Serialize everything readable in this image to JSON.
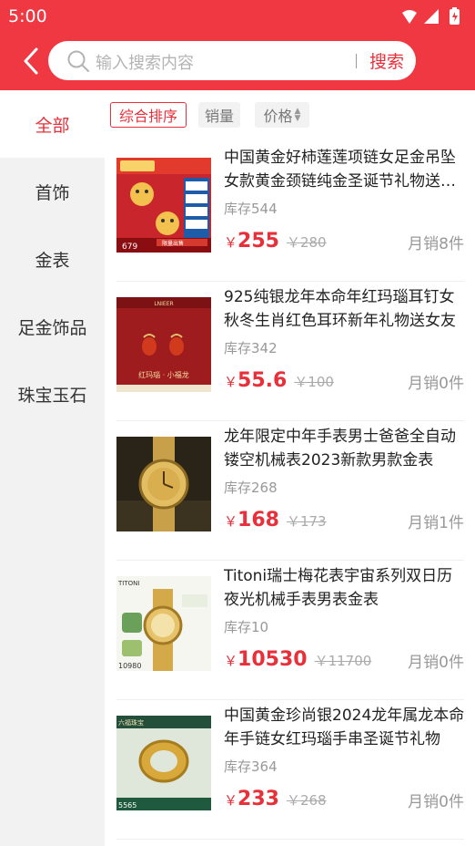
{
  "status": {
    "time": "5:00"
  },
  "search": {
    "placeholder": "输入搜索内容",
    "button": "搜索"
  },
  "sidebar": {
    "items": [
      {
        "label": "全部",
        "active": true
      },
      {
        "label": "首饰"
      },
      {
        "label": "金表"
      },
      {
        "label": "足金饰品"
      },
      {
        "label": "珠宝玉石"
      }
    ]
  },
  "sort": {
    "comprehensive": "综合排序",
    "sales": "销量",
    "price": "价格"
  },
  "products": [
    {
      "title": "中国黄金好柿莲莲项链女足金吊坠女款黄金颈链纯金圣诞节礼物送女友",
      "stock": "库存544",
      "currency": "￥",
      "price": "255",
      "original": "￥280",
      "sales": "月销8件"
    },
    {
      "title": "925纯银龙年本命年红玛瑙耳钉女秋冬生肖红色耳环新年礼物送女友",
      "stock": "库存342",
      "currency": "￥",
      "price": "55.6",
      "original": "￥100",
      "sales": "月销0件"
    },
    {
      "title": "龙年限定中年手表男士爸爸全自动镂空机械表2023新款男款金表",
      "stock": "库存268",
      "currency": "￥",
      "price": "168",
      "original": "￥173",
      "sales": "月销1件"
    },
    {
      "title": "Titoni瑞士梅花表宇宙系列双日历夜光机械手表男表金表",
      "stock": "库存10",
      "currency": "￥",
      "price": "10530",
      "original": "￥11700",
      "sales": "月销0件"
    },
    {
      "title": "中国黄金珍尚银2024龙年属龙本命年手链女红玛瑙手串圣诞节礼物",
      "stock": "库存364",
      "currency": "￥",
      "price": "233",
      "original": "￥268",
      "sales": "月销0件"
    }
  ],
  "thumb_text": {
    "p1_badge": "限量出售",
    "p1_price": "679",
    "p2_caption": "红玛瑙 · 小福龙",
    "p2_brand": "LNIEER",
    "p4_brand": "TITONI",
    "p4_price": "10980",
    "p5_brand": "六福珠宝",
    "p5_price": "5565"
  },
  "colors": {
    "primary": "#f03843",
    "price": "#e8303a"
  }
}
